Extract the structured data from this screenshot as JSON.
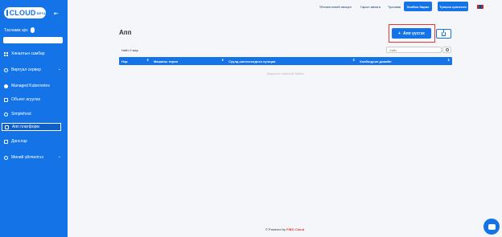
{
  "sidebar": {
    "logo_text": "CLOUD",
    "logo_tag": "BETA",
    "theme_label": "Тасламж эрх",
    "items": [
      {
        "label": "Хяналтын самбар",
        "icon": "dashboard-icon"
      },
      {
        "label": "Виртуал сервер",
        "icon": "cloud-icon",
        "has_chevron": true
      },
      {
        "label": "Managed Kubernetes",
        "icon": "kubernetes-icon"
      },
      {
        "label": "Объект агуулах",
        "icon": "storage-icon"
      },
      {
        "label": "Simplehost",
        "icon": "globe-icon"
      },
      {
        "label": "Апп платформ",
        "icon": "app-platform-icon",
        "active": true
      },
      {
        "label": "Данслар",
        "icon": "billing-icon"
      },
      {
        "label": "Миний үйлчилгээ",
        "icon": "user-icon",
        "has_chevron": true
      }
    ]
  },
  "topbar": {
    "links": [
      "Үйлчилгээний нөхцөл",
      "Гарын авлага",
      "Тусламж"
    ],
    "buttons": [
      "Холбоо барих",
      "Түлшээ цэнэглэх"
    ],
    "language_flag": "MN"
  },
  "main": {
    "title": "Апп",
    "add_button_label": "Апп үүсгэх",
    "add_button_icon": "plus-icon",
    "total_label": "Нийт 0 мөр",
    "search_placeholder": "Хайх",
    "table_headers": [
      "Нэр",
      "Машины төрөл",
      "Сүүлд шинэчлэгдсэн хугацаа",
      "Холбогдсон домайн"
    ],
    "empty_text": "Мэдээлэл байхгүй байна."
  },
  "footer": {
    "prefix": "© Powered by",
    "brand": "FIBO Cloud"
  },
  "colors": {
    "primary": "#1473e6",
    "highlight": "#e53935",
    "background": "#f4f6f9"
  }
}
